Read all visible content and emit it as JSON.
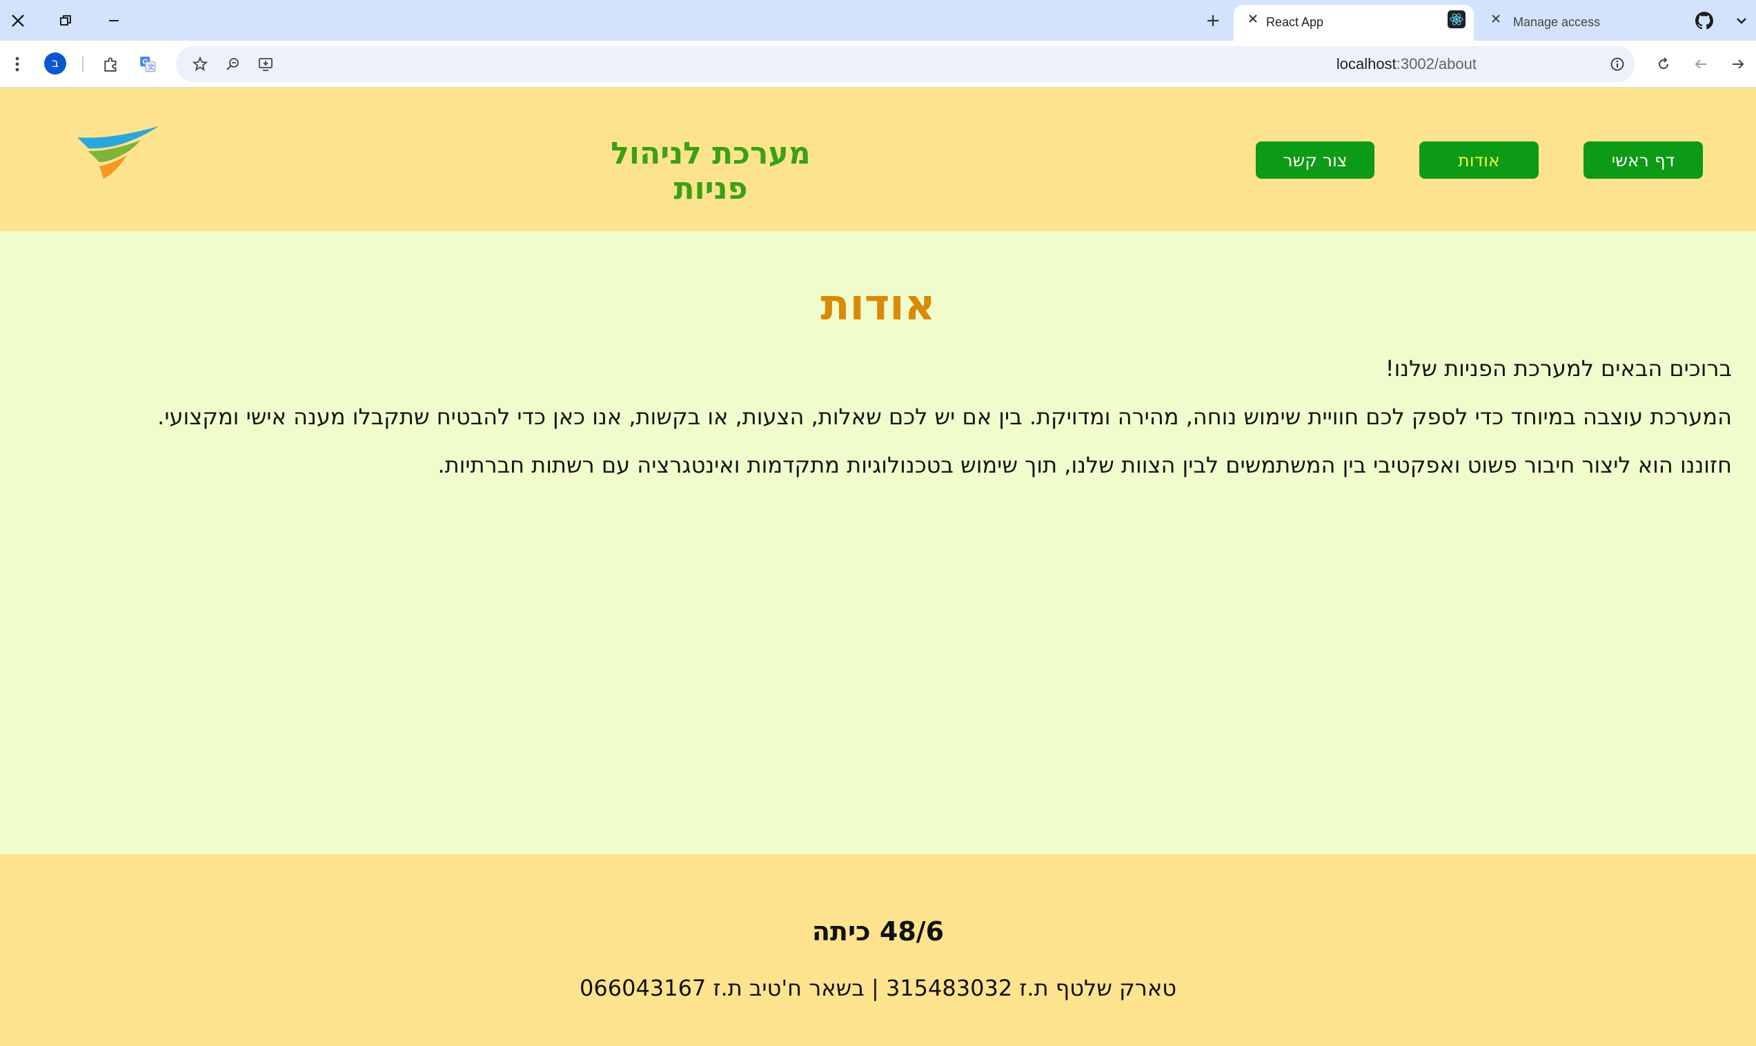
{
  "browser": {
    "tabs": [
      {
        "title": "Manage access",
        "active": false
      },
      {
        "title": "React App",
        "active": true
      }
    ],
    "url_host": "localhost",
    "url_path": ":3002/about",
    "profile_initial": "ב",
    "icons": [
      "close-icon",
      "restore-icon",
      "minimize-icon",
      "new-tab-icon",
      "github-icon",
      "tab-search-icon",
      "menu-icon",
      "extensions-icon",
      "translate-icon",
      "bookmark-star-icon",
      "zoom-icon",
      "install-app-icon",
      "site-info-icon",
      "reload-icon",
      "back-icon",
      "forward-icon"
    ]
  },
  "header": {
    "site_title": "מערכת לניהול פניות",
    "nav": {
      "home": "דף ראשי",
      "about": "אודות",
      "contact": "צור קשר"
    }
  },
  "main": {
    "title": "אודות",
    "paragraphs": [
      "ברוכים הבאים למערכת הפניות שלנו!",
      "המערכת עוצבה במיוחד כדי לספק לכם חוויית שימוש נוחה, מהירה ומדויקת. בין אם יש לכם שאלות, הצעות, או בקשות, אנו כאן כדי להבטיח שתקבלו מענה אישי ומקצועי.",
      "חזוננו הוא ליצור חיבור פשוט ואפקטיבי בין המשתמשים לבין הצוות שלנו, תוך שימוש בטכנולוגיות מתקדמות ואינטגרציה עם רשתות חברתיות."
    ]
  },
  "footer": {
    "class_label": "48/6 כיתה",
    "authors": "טארק שלטף ת.ז 315483032 | בשאר ח'טיב ת.ז 066043167"
  },
  "colors": {
    "header_bg": "#fee38e",
    "content_bg": "#f1fccc",
    "nav_button": "#0d9a16",
    "title_green": "#3aa014",
    "about_orange": "#d98a06",
    "active_nav_text": "#f7f430"
  }
}
